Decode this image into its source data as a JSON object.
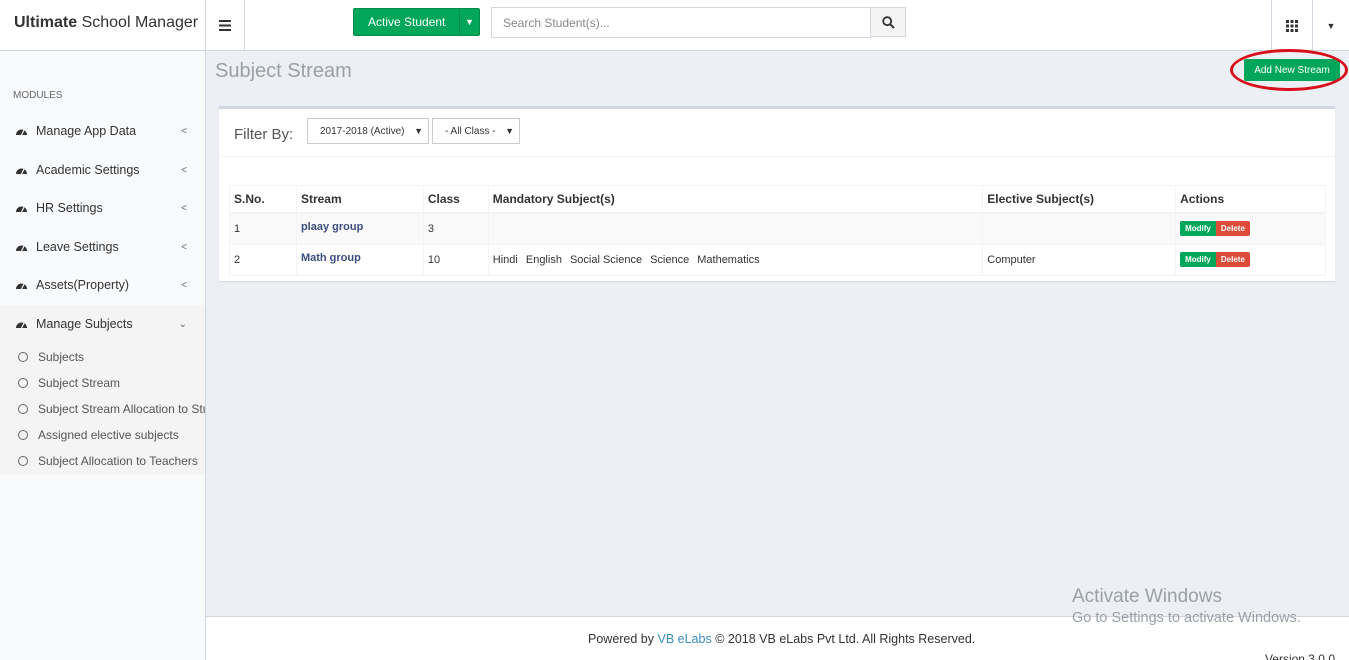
{
  "brand": {
    "bold": "Ultimate",
    "rest": " School Manager"
  },
  "header": {
    "active_student_label": "Active Student",
    "search_placeholder": "Search Student(s)..."
  },
  "sidebar": {
    "header": "MODULES",
    "items": [
      {
        "label": "Manage App Data"
      },
      {
        "label": "Academic Settings"
      },
      {
        "label": "HR Settings"
      },
      {
        "label": "Leave Settings"
      },
      {
        "label": "Assets(Property)"
      },
      {
        "label": "Manage Subjects"
      }
    ],
    "sub_items": [
      {
        "label": "Subjects"
      },
      {
        "label": "Subject Stream"
      },
      {
        "label": "Subject Stream Allocation to Stu"
      },
      {
        "label": "Assigned elective subjects"
      },
      {
        "label": "Subject Allocation to Teachers"
      }
    ]
  },
  "page": {
    "title": "Subject Stream",
    "add_button": "Add New Stream"
  },
  "filter": {
    "label": "Filter By:",
    "year_value": "2017-2018 (Active)",
    "class_value": "- All Class -"
  },
  "table": {
    "headers": [
      "S.No.",
      "Stream",
      "Class",
      "Mandatory Subject(s)",
      "Elective Subject(s)",
      "Actions"
    ],
    "rows": [
      {
        "sno": "1",
        "stream": "plaay group",
        "class": "3",
        "mandatory": [],
        "elective": ""
      },
      {
        "sno": "2",
        "stream": "Math group",
        "class": "10",
        "mandatory": [
          "Hindi",
          "English",
          "Social Science",
          "Science",
          "Mathematics"
        ],
        "elective": "Computer"
      }
    ],
    "modify_label": "Modify",
    "delete_label": "Delete"
  },
  "footer": {
    "powered_by": "Powered by",
    "link": "VB eLabs",
    "copyright": "© 2018 VB eLabs Pvt Ltd. All Rights Reserved.",
    "version": "Version 3.0.0"
  },
  "watermark": {
    "line1": "Activate Windows",
    "line2": "Go to Settings to activate Windows."
  },
  "colors": {
    "accent_green": "#00a65a",
    "danger_red": "#dd4b39",
    "highlight_circle": "#d8101c"
  }
}
